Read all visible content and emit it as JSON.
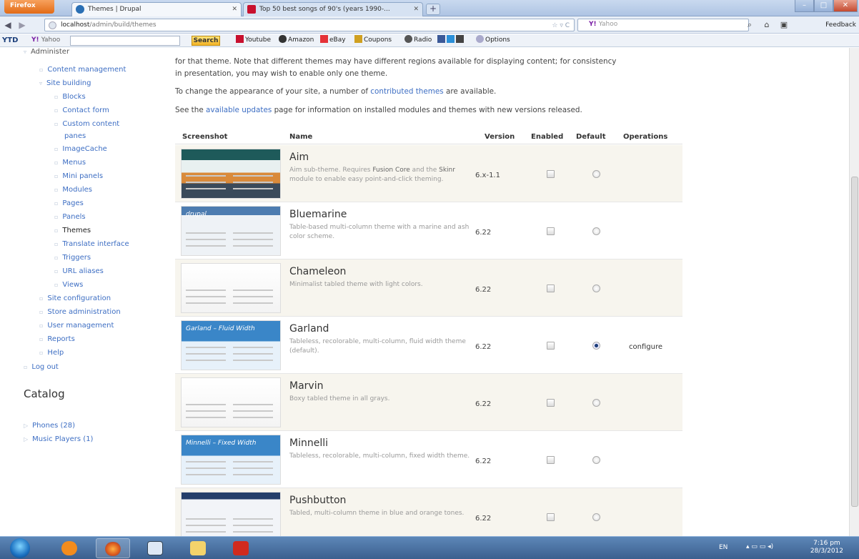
{
  "browser": {
    "firefox_button": "Firefox",
    "tabs": [
      {
        "title": "Themes | Drupal"
      },
      {
        "title": "Top 50 best songs of 90's (years 1990-..."
      }
    ],
    "url_host": "localhost",
    "url_path": "/admin/build/themes",
    "search_engine": "Yahoo",
    "feedback_label": "Feedback"
  },
  "toolbar": {
    "ytd": "YTD",
    "yahoo_label": "Yahoo",
    "search_label": "Search",
    "items": [
      "Youtube",
      "Amazon",
      "eBay",
      "Coupons",
      "Radio",
      "Options"
    ]
  },
  "sidebar": {
    "items": [
      {
        "label": "Administer"
      },
      {
        "label": "Content management"
      },
      {
        "label": "Site building"
      },
      {
        "label": "Blocks"
      },
      {
        "label": "Contact form"
      },
      {
        "label": "Custom content"
      },
      {
        "label": "panes"
      },
      {
        "label": "ImageCache"
      },
      {
        "label": "Menus"
      },
      {
        "label": "Mini panels"
      },
      {
        "label": "Modules"
      },
      {
        "label": "Pages"
      },
      {
        "label": "Panels"
      },
      {
        "label": "Themes"
      },
      {
        "label": "Translate interface"
      },
      {
        "label": "Triggers"
      },
      {
        "label": "URL aliases"
      },
      {
        "label": "Views"
      },
      {
        "label": "Site configuration"
      },
      {
        "label": "Store administration"
      },
      {
        "label": "User management"
      },
      {
        "label": "Reports"
      },
      {
        "label": "Help"
      },
      {
        "label": "Log out"
      }
    ],
    "catalog_title": "Catalog",
    "catalog_items": [
      {
        "label": "Phones (28)"
      },
      {
        "label": "Music Players (1)"
      }
    ]
  },
  "main": {
    "intro_line1": "for that theme. Note that different themes may have different regions available for displaying content; for consistency",
    "intro_line2": "in presentation, you may wish to enable only one theme.",
    "change_pre": "To change the appearance of your site, a number of ",
    "change_link": "contributed themes",
    "change_post": " are available.",
    "updates_pre": "See the ",
    "updates_link": "available updates",
    "updates_post": " page for information on installed modules and themes with new versions released.",
    "columns": {
      "screenshot": "Screenshot",
      "name": "Name",
      "version": "Version",
      "enabled": "Enabled",
      "default": "Default",
      "operations": "Operations"
    },
    "themes": [
      {
        "name": "Aim",
        "desc_pre": "Aim sub-theme. Requires ",
        "desc_hl1": "Fusion Core",
        "desc_mid": " and the ",
        "desc_hl2": "Skinr",
        "desc_post": " module to enable easy point-and-click theming.",
        "version": "6.x-1.1",
        "default": false,
        "op": ""
      },
      {
        "name": "Bluemarine",
        "desc_pre": "Table-based multi-column theme with a marine and ash color scheme.",
        "desc_hl1": "",
        "desc_mid": "",
        "desc_hl2": "",
        "desc_post": "",
        "version": "6.22",
        "default": false,
        "op": ""
      },
      {
        "name": "Chameleon",
        "desc_pre": "Minimalist tabled theme with light colors.",
        "desc_hl1": "",
        "desc_mid": "",
        "desc_hl2": "",
        "desc_post": "",
        "version": "6.22",
        "default": false,
        "op": ""
      },
      {
        "name": "Garland",
        "desc_pre": "Tableless, recolorable, multi-column, fluid width theme (default).",
        "desc_hl1": "",
        "desc_mid": "",
        "desc_hl2": "",
        "desc_post": "",
        "version": "6.22",
        "default": true,
        "op": "configure"
      },
      {
        "name": "Marvin",
        "desc_pre": "Boxy tabled theme in all grays.",
        "desc_hl1": "",
        "desc_mid": "",
        "desc_hl2": "",
        "desc_post": "",
        "version": "6.22",
        "default": false,
        "op": ""
      },
      {
        "name": "Minnelli",
        "desc_pre": "Tableless, recolorable, multi-column, fixed width theme.",
        "desc_hl1": "",
        "desc_mid": "",
        "desc_hl2": "",
        "desc_post": "",
        "version": "6.22",
        "default": false,
        "op": ""
      },
      {
        "name": "Pushbutton",
        "desc_pre": "Tabled, multi-column theme in blue and orange tones.",
        "desc_hl1": "",
        "desc_mid": "",
        "desc_hl2": "",
        "desc_post": "",
        "version": "6.22",
        "default": false,
        "op": ""
      }
    ],
    "thumb_labels": {
      "garland": "Garland – Fluid Width",
      "minnelli": "Minnelli – Fixed Width",
      "bluemarine": "drupal"
    }
  },
  "taskbar": {
    "lang": "EN",
    "clock_time": "7:16 pm",
    "clock_date": "28/3/2012"
  },
  "colors": {
    "link": "#3d6ec3",
    "row_stripe": "#f7f5ee",
    "taskbar": "#3b5f8e"
  }
}
